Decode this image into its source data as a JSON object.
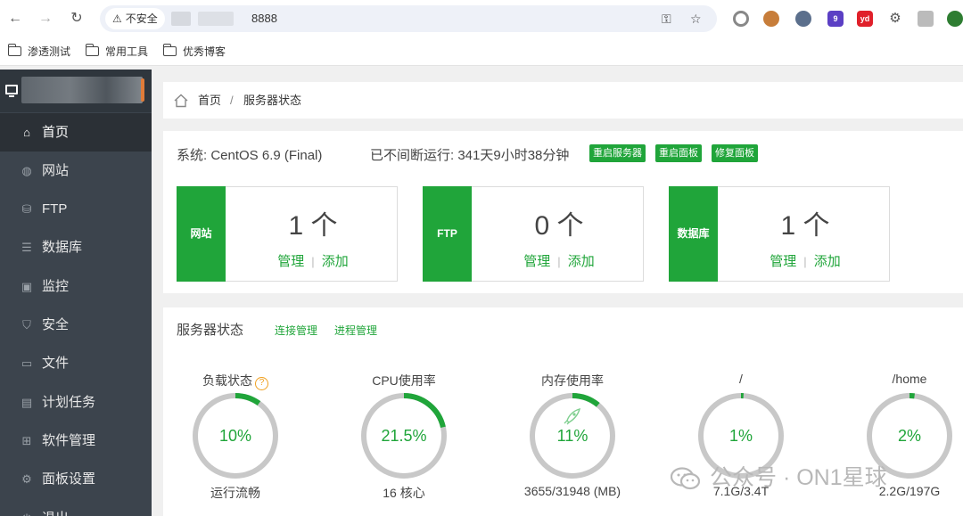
{
  "browser": {
    "security_label": "不安全",
    "url_port": "8888",
    "bookmarks": [
      {
        "label": "渗透测试"
      },
      {
        "label": "常用工具"
      },
      {
        "label": "优秀博客"
      }
    ],
    "extension_badges": {
      "purple": "9",
      "red": "yd"
    }
  },
  "sidebar": {
    "items": [
      {
        "label": "首页",
        "icon": "home-icon"
      },
      {
        "label": "网站",
        "icon": "globe-icon"
      },
      {
        "label": "FTP",
        "icon": "ftp-icon"
      },
      {
        "label": "数据库",
        "icon": "database-icon"
      },
      {
        "label": "监控",
        "icon": "monitor-icon"
      },
      {
        "label": "安全",
        "icon": "shield-icon"
      },
      {
        "label": "文件",
        "icon": "folder-icon"
      },
      {
        "label": "计划任务",
        "icon": "calendar-icon"
      },
      {
        "label": "软件管理",
        "icon": "apps-icon"
      },
      {
        "label": "面板设置",
        "icon": "settings-icon"
      },
      {
        "label": "退出",
        "icon": "logout-icon"
      }
    ]
  },
  "breadcrumb": {
    "home": "首页",
    "separator": "/",
    "current": "服务器状态"
  },
  "system": {
    "os": "系统: CentOS 6.9 (Final)",
    "uptime": "已不间断运行: 341天9小时38分钟",
    "buttons": [
      "重启服务器",
      "重启面板",
      "修复面板"
    ]
  },
  "stats": [
    {
      "tag": "网站",
      "count": "1 个",
      "manage": "管理",
      "add": "添加"
    },
    {
      "tag": "FTP",
      "count": "0 个",
      "manage": "管理",
      "add": "添加"
    },
    {
      "tag": "数据库",
      "count": "1 个",
      "manage": "管理",
      "add": "添加"
    }
  ],
  "server_status": {
    "title": "服务器状态",
    "links": [
      "连接管理",
      "进程管理"
    ],
    "gauges": [
      {
        "label": "负载状态",
        "value": "10%",
        "percent": 10,
        "sub": "运行流畅",
        "help": "?"
      },
      {
        "label": "CPU使用率",
        "value": "21.5%",
        "percent": 21.5,
        "sub": "16 核心"
      },
      {
        "label": "内存使用率",
        "value": "11%",
        "percent": 11,
        "sub": "3655/31948 (MB)"
      },
      {
        "label": "/",
        "value": "1%",
        "percent": 1,
        "sub": "7.1G/3.4T"
      },
      {
        "label": "/home",
        "value": "2%",
        "percent": 2,
        "sub": "2.2G/197G"
      }
    ]
  },
  "watermark": {
    "text": "公众号 · ON1星球"
  },
  "colors": {
    "accent": "#20a53a",
    "sidebar": "#3c444d",
    "sidebar_active": "#2b3036",
    "ring_track": "#c8c8c8"
  }
}
